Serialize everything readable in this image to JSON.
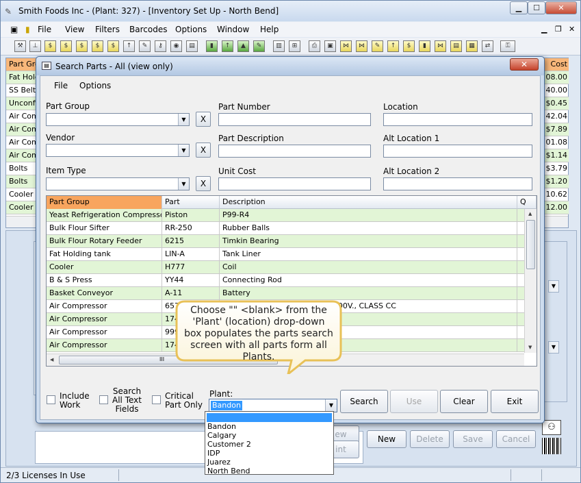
{
  "main": {
    "title": "Smith Foods Inc - (Plant: 327) - [Inventory Set Up - North Bend]",
    "menu": [
      "File",
      "View",
      "Filters",
      "Barcodes",
      "Options",
      "Window",
      "Help"
    ],
    "bg_rows": [
      {
        "left": "Part Gro",
        "cost": "Cost",
        "style": "orange"
      },
      {
        "left": "Fat Hold",
        "cost": "08.00",
        "style": "green"
      },
      {
        "left": "SS Belti",
        "cost": "40.00",
        "style": "white"
      },
      {
        "left": "Unconfi",
        "cost": "$0.45",
        "style": "green"
      },
      {
        "left": "Air Com",
        "cost": "42.04",
        "style": "white"
      },
      {
        "left": "Air Com",
        "cost": "$7.89",
        "style": "green"
      },
      {
        "left": "Air Com",
        "cost": "01.08",
        "style": "white"
      },
      {
        "left": "Air Com",
        "cost": "$1.14",
        "style": "green"
      },
      {
        "left": "Bolts",
        "cost": "$3.79",
        "style": "white"
      },
      {
        "left": "Bolts",
        "cost": "$1.20",
        "style": "green"
      },
      {
        "left": "Cooler",
        "cost": "10.62",
        "style": "white"
      },
      {
        "left": "Cooler",
        "cost": "12.00",
        "style": "green"
      }
    ],
    "buttons": {
      "new": "New",
      "delete": "Delete",
      "save": "Save",
      "cancel": "Cancel",
      "view_partial": "ew",
      "print_partial": "int"
    },
    "status": "2/3 Licenses In Use"
  },
  "dialog": {
    "title": "Search Parts - All (view only)",
    "menu": {
      "file": "File",
      "options": "Options"
    },
    "labels": {
      "part_group": "Part Group",
      "vendor": "Vendor",
      "item_type": "Item Type",
      "part_number": "Part Number",
      "part_description": "Part Description",
      "unit_cost": "Unit Cost",
      "location": "Location",
      "alt_location_1": "Alt Location 1",
      "alt_location_2": "Alt Location 2"
    },
    "clear_x": "X",
    "grid": {
      "headers": [
        "Part Group",
        "Part",
        "Description",
        "Q"
      ],
      "rows": [
        [
          "Yeast Refrigeration Compressor",
          "Piston",
          "P99-R4"
        ],
        [
          "Bulk Flour Sifter",
          "RR-250",
          "Rubber Balls"
        ],
        [
          "Bulk Flour Rotary Feeder",
          "6215",
          "Timkin Bearing"
        ],
        [
          "Fat Holding tank",
          "LIN-A",
          "Tank Liner"
        ],
        [
          "Cooler",
          "H777",
          "Coil"
        ],
        [
          "B & S Press",
          "YY44",
          "Connecting Rod"
        ],
        [
          "Basket Conveyor",
          "A-11",
          "Battery"
        ],
        [
          "Air Compressor",
          "6575",
          "RANSFORMER FUSE, 15 AMP. 600V., CLASS CC"
        ],
        [
          "Air Compressor",
          "174",
          ""
        ],
        [
          "Air Compressor",
          "999",
          ""
        ],
        [
          "Air Compressor",
          "174",
          ""
        ]
      ],
      "scroll_grip": "III"
    },
    "checkboxes": {
      "include_work": "Include\nWork",
      "search_all": "Search\nAll Text\nFields",
      "critical": "Critical\nPart Only"
    },
    "plant": {
      "label": "Plant:",
      "value": "Bandon",
      "options": [
        "",
        "Bandon",
        "Calgary",
        "Customer 2",
        "IDP",
        "Juarez",
        "North Bend"
      ]
    },
    "buttons": {
      "search": "Search",
      "use": "Use",
      "clear": "Clear",
      "exit": "Exit"
    }
  },
  "callout": {
    "text": "Choose \"\" <blank> from the 'Plant' (location) drop-down box populates the parts search screen with all parts form all Plants."
  }
}
